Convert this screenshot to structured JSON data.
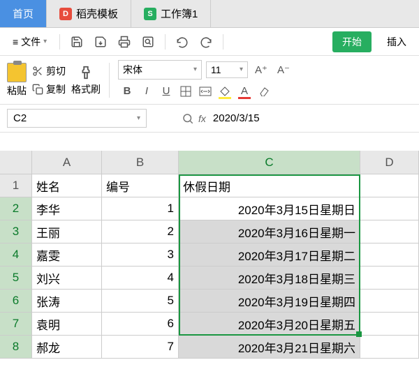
{
  "tabs": {
    "home": "首页",
    "template": "稻壳模板",
    "workbook": "工作簿1"
  },
  "menu": {
    "file": "文件"
  },
  "ribbon": {
    "start": "开始",
    "insert": "插入"
  },
  "clipboard": {
    "paste": "粘贴",
    "cut": "剪切",
    "copy": "复制",
    "brush": "格式刷"
  },
  "font": {
    "name": "宋体",
    "size": "11"
  },
  "namebox": "C2",
  "formula": "2020/3/15",
  "columns": {
    "a": "A",
    "b": "B",
    "c": "C",
    "d": "D"
  },
  "rows": [
    "1",
    "2",
    "3",
    "4",
    "5",
    "6",
    "7",
    "8"
  ],
  "header": {
    "a": "姓名",
    "b": "编号",
    "c": "休假日期"
  },
  "data": [
    {
      "a": "李华",
      "b": "1",
      "c": "2020年3月15日星期日"
    },
    {
      "a": "王丽",
      "b": "2",
      "c": "2020年3月16日星期一"
    },
    {
      "a": "嘉雯",
      "b": "3",
      "c": "2020年3月17日星期二"
    },
    {
      "a": "刘兴",
      "b": "4",
      "c": "2020年3月18日星期三"
    },
    {
      "a": "张涛",
      "b": "5",
      "c": "2020年3月19日星期四"
    },
    {
      "a": "袁明",
      "b": "6",
      "c": "2020年3月20日星期五"
    },
    {
      "a": "郝龙",
      "b": "7",
      "c": "2020年3月21日星期六"
    }
  ]
}
